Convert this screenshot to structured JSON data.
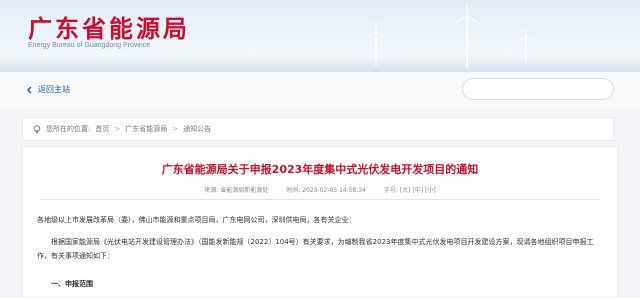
{
  "header": {
    "site_title": "广东省能源局",
    "site_subtitle": "Energy Bureau of Guangdong Province"
  },
  "nav": {
    "back_home": "返回主站",
    "search_placeholder": ""
  },
  "breadcrumb": {
    "prefix": "您所在的位置:",
    "items": [
      "首页",
      "广东省能源局",
      "通知公告"
    ]
  },
  "article": {
    "title": "广东省能源局关于申报2023年度集中式光伏发电开发项目的通知",
    "meta": {
      "source": "来源: 省能源局新能源处",
      "time": "时间: 2023-02-03 14:58:34",
      "font_size": "字号: [大] [中] [小]"
    },
    "paragraphs": [
      "各地级以上市发展改革局（委），佛山市能源和重点项目局，广东电网公司，深圳供电局，各有关企业：",
      "根据国家能源局《光伏电站开发建设管理办法》（国能发新能规〔2022〕104号）有关要求，为编制我省2023年度集中式光伏发电项目开发建设方案，现请各地组织项目申报工作，有关事项通知如下：",
      "一、申报范围"
    ]
  },
  "colors": {
    "title_red": "#c8102e",
    "link_blue": "#1f5fa8"
  },
  "icons": [
    "back-arrow-icon",
    "wind-turbine-icon",
    "location-pin-icon"
  ]
}
